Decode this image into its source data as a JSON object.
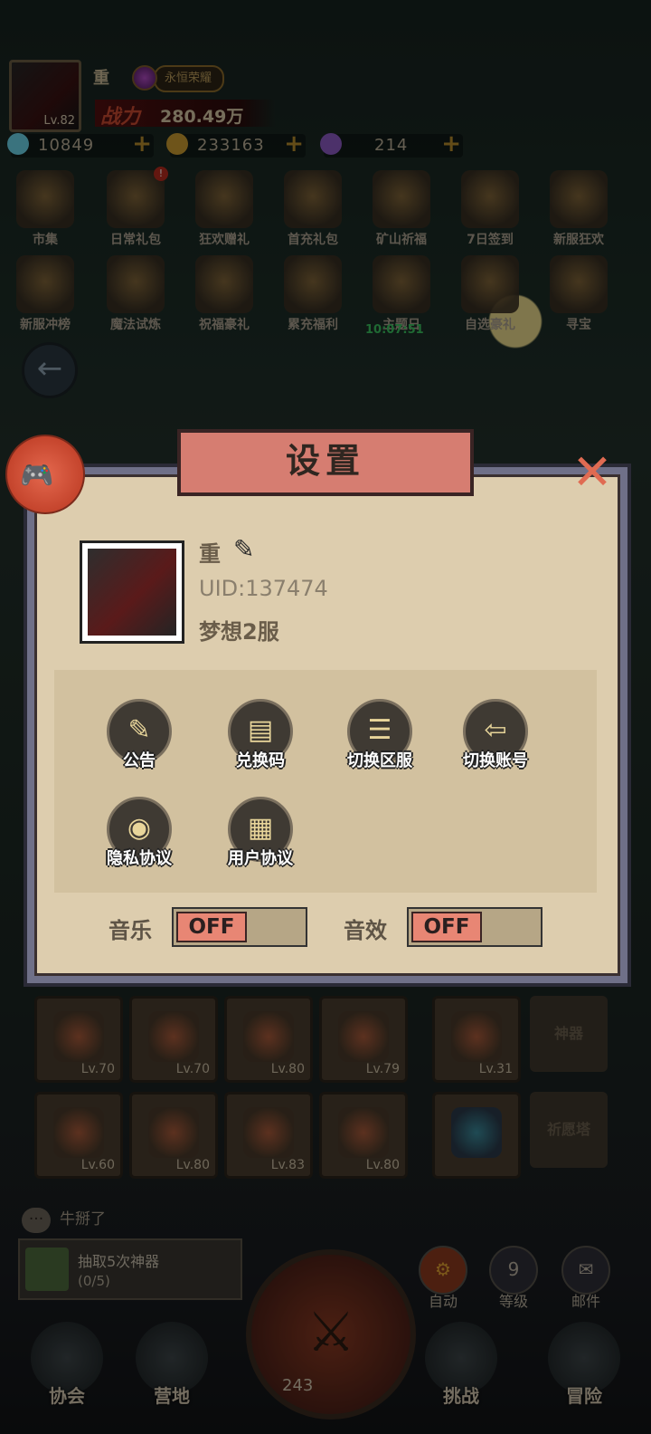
{
  "player": {
    "name": "重",
    "level": "Lv.82",
    "server_tag": "永恒荣耀",
    "power_label": "战力",
    "power_value": "280.49万"
  },
  "resources": [
    {
      "icon": "diamond-icon",
      "value": "10849",
      "color": "#6ad1e6"
    },
    {
      "icon": "gold-coin-icon",
      "value": "233163",
      "color": "#c99a30"
    },
    {
      "icon": "star-icon",
      "value": "214",
      "color": "#8a5ac2"
    }
  ],
  "menu_row1": [
    "市集",
    "日常礼包",
    "狂欢赠礼",
    "首充礼包",
    "矿山祈福",
    "7日签到",
    "新服狂欢"
  ],
  "menu_row2": [
    "新服冲榜",
    "魔法试炼",
    "祝福豪礼",
    "累充福利",
    "主题日",
    "自选豪礼",
    "寻宝"
  ],
  "menu_badge": "!",
  "timer": "10:07:51",
  "dialog": {
    "title": "设置",
    "close_icon": "close-x-icon",
    "name": "重",
    "uid": "UID:137474",
    "server": "梦想2服",
    "options": [
      {
        "label": "公告",
        "icon": "announcement-icon"
      },
      {
        "label": "兑换码",
        "icon": "redeem-code-icon"
      },
      {
        "label": "切换区服",
        "icon": "switch-server-icon"
      },
      {
        "label": "切换账号",
        "icon": "switch-account-icon"
      },
      {
        "label": "隐私协议",
        "icon": "privacy-icon"
      },
      {
        "label": "用户协议",
        "icon": "user-agreement-icon"
      }
    ],
    "music_label": "音乐",
    "music_state": "OFF",
    "sound_label": "音效",
    "sound_state": "OFF"
  },
  "equipment": [
    "Lv.70",
    "Lv.70",
    "Lv.80",
    "Lv.79",
    "Lv.31",
    "Lv.60",
    "Lv.80",
    "Lv.83",
    "Lv.80"
  ],
  "side_buttons": [
    "神器",
    "祈愿塔"
  ],
  "chat": {
    "bubble": "···",
    "text": "牛掰了"
  },
  "task": {
    "title": "抽取5次神器",
    "progress": "(0/5)"
  },
  "side_actions": [
    {
      "label": "自动",
      "icon": "gear-icon"
    },
    {
      "label": "等级",
      "icon": "level-icon",
      "value": "9"
    },
    {
      "label": "邮件",
      "icon": "mail-icon"
    }
  ],
  "center": {
    "value": "243"
  },
  "bottom_nav": [
    "协会",
    "营地",
    "挑战",
    "冒险"
  ]
}
